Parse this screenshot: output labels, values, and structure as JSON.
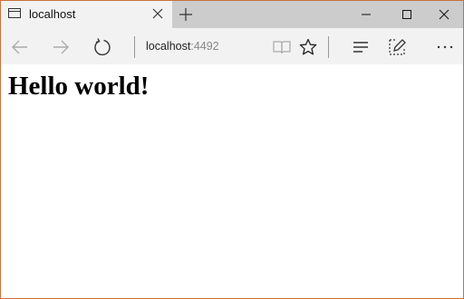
{
  "tab": {
    "title": "localhost",
    "close_icon": "close-icon",
    "page_icon": "page-icon"
  },
  "toolbar": {
    "address_host": "localhost",
    "address_port": ":4492",
    "icons": [
      "back-icon",
      "forward-icon",
      "refresh-icon",
      "reading-view-icon",
      "favorite-star-icon",
      "hub-icon",
      "web-note-icon",
      "more-icon"
    ]
  },
  "page": {
    "heading": "Hello world!"
  },
  "colors": {
    "window_border": "#c8723b",
    "titlebar_bg": "#cccccc",
    "toolbar_bg": "#f2f2f2"
  }
}
